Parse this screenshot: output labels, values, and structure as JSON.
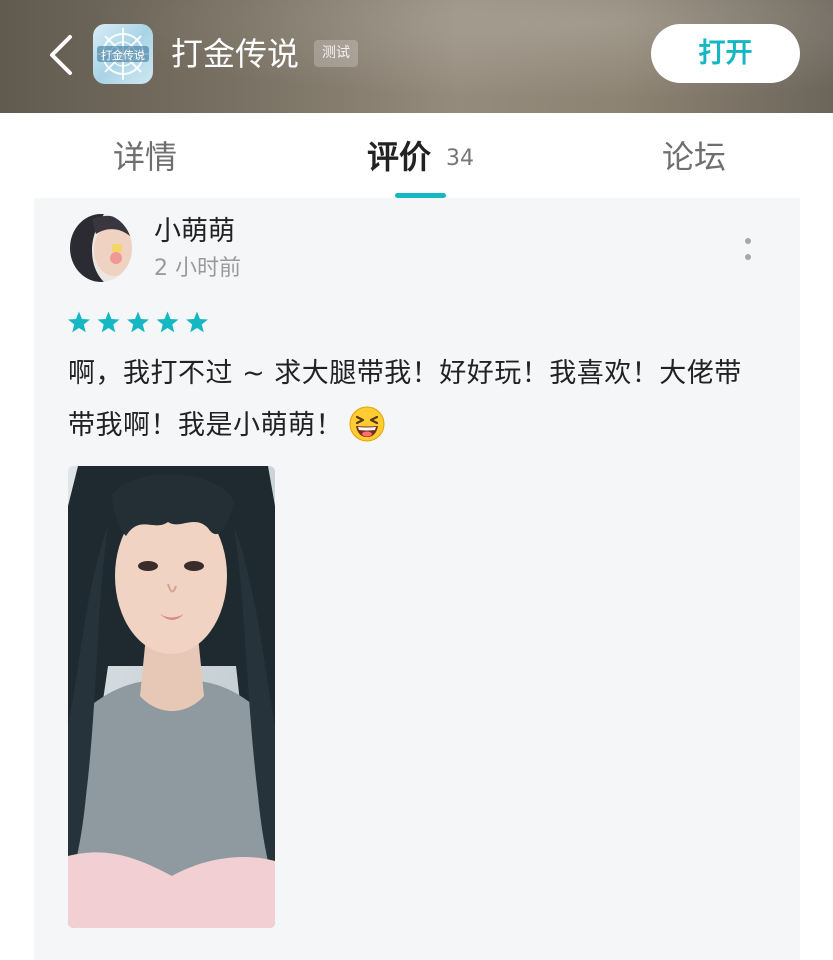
{
  "header": {
    "app_name": "打金传说",
    "badge": "测试",
    "open_button": "打开"
  },
  "tabs": {
    "details": "详情",
    "reviews": "评价",
    "reviews_count": "34",
    "forum": "论坛",
    "active": "reviews"
  },
  "review": {
    "username": "小萌萌",
    "time": "2 小时前",
    "rating": 5,
    "rating_max": 5,
    "text": "啊，我打不过 ~ 求大腿带我！好好玩！我喜欢！大佬带带我啊！我是小萌萌！",
    "emoji": "laughing-face"
  },
  "colors": {
    "accent": "#15b7c2",
    "header_bg": "#7a7264",
    "card_bg": "#f4f6f8",
    "text": "#222222",
    "muted": "#9a9a9a"
  }
}
